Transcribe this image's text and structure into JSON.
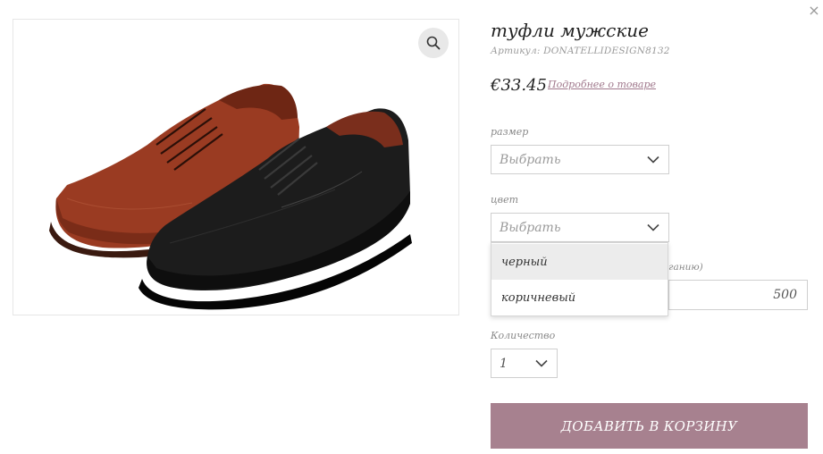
{
  "modal": {
    "close_symbol": "×"
  },
  "product": {
    "title": "туфли мужские",
    "sku": "Артикул: DONATELLIDESIGN8132",
    "price": "€33.45",
    "details_link": "Подробнее о товаре"
  },
  "gallery": {
    "zoom_icon": "magnifier-icon",
    "image_alt": "туфли мужские"
  },
  "size_field": {
    "label": "размер",
    "value": "Выбрать"
  },
  "color_field": {
    "label": "цвет",
    "value": "Выбрать",
    "options": [
      "черный",
      "коричневый"
    ],
    "highlighted_index": 0
  },
  "partial_field": {
    "label_fragment": "ксганию)",
    "value": "500"
  },
  "quantity_field": {
    "label": "Количество",
    "value": "1"
  },
  "actions": {
    "add_to_cart": "ДОБАВИТЬ В КОРЗИНУ"
  },
  "colors": {
    "accent": "#a7818f",
    "link": "#a0788c",
    "brown_shoe": "#9a3b22",
    "black_shoe": "#1a1a1a"
  }
}
